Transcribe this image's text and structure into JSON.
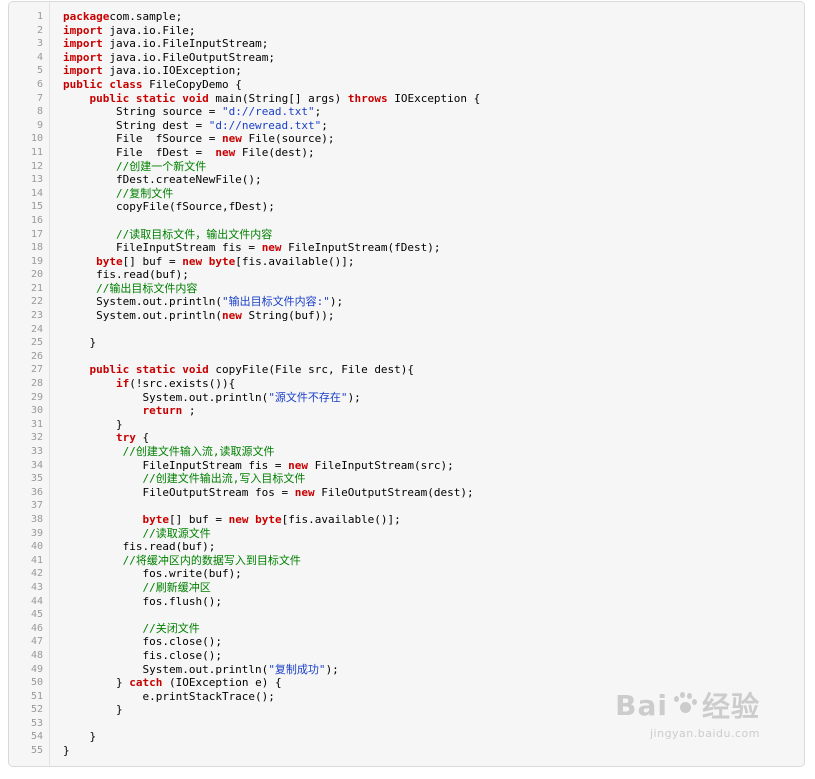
{
  "code": {
    "lines": [
      {
        "n": "1",
        "tokens": [
          [
            "kw",
            "package"
          ],
          [
            "",
            "com.sample;"
          ]
        ]
      },
      {
        "n": "2",
        "tokens": [
          [
            "kw",
            "import"
          ],
          [
            "",
            " java.io.File;"
          ]
        ]
      },
      {
        "n": "3",
        "tokens": [
          [
            "kw",
            "import"
          ],
          [
            "",
            " java.io.FileInputStream;"
          ]
        ]
      },
      {
        "n": "4",
        "tokens": [
          [
            "kw",
            "import"
          ],
          [
            "",
            " java.io.FileOutputStream;"
          ]
        ]
      },
      {
        "n": "5",
        "tokens": [
          [
            "kw",
            "import"
          ],
          [
            "",
            " java.io.IOException;"
          ]
        ]
      },
      {
        "n": "6",
        "tokens": [
          [
            "kw",
            "public"
          ],
          [
            "",
            " "
          ],
          [
            "kw",
            "class"
          ],
          [
            "",
            " FileCopyDemo {"
          ]
        ]
      },
      {
        "n": "7",
        "tokens": [
          [
            "",
            "    "
          ],
          [
            "kw",
            "public"
          ],
          [
            "",
            " "
          ],
          [
            "kw",
            "static"
          ],
          [
            "",
            " "
          ],
          [
            "kw",
            "void"
          ],
          [
            "",
            " main(String[] args) "
          ],
          [
            "kw",
            "throws"
          ],
          [
            "",
            " IOException {"
          ]
        ]
      },
      {
        "n": "8",
        "tokens": [
          [
            "",
            "        String source = "
          ],
          [
            "str",
            "\"d://read.txt\""
          ],
          [
            "",
            ";"
          ]
        ]
      },
      {
        "n": "9",
        "tokens": [
          [
            "",
            "        String dest = "
          ],
          [
            "str",
            "\"d://newread.txt\""
          ],
          [
            "",
            ";"
          ]
        ]
      },
      {
        "n": "10",
        "tokens": [
          [
            "",
            "        File  fSource = "
          ],
          [
            "kw",
            "new"
          ],
          [
            "",
            " File(source);"
          ]
        ]
      },
      {
        "n": "11",
        "tokens": [
          [
            "",
            "        File  fDest =  "
          ],
          [
            "kw",
            "new"
          ],
          [
            "",
            " File(dest);"
          ]
        ]
      },
      {
        "n": "12",
        "tokens": [
          [
            "",
            "        "
          ],
          [
            "cm",
            "//创建一个新文件"
          ]
        ]
      },
      {
        "n": "13",
        "tokens": [
          [
            "",
            "        fDest.createNewFile();"
          ]
        ]
      },
      {
        "n": "14",
        "tokens": [
          [
            "",
            "        "
          ],
          [
            "cm",
            "//复制文件"
          ]
        ]
      },
      {
        "n": "15",
        "tokens": [
          [
            "",
            "        copyFile(fSource,fDest);"
          ]
        ]
      },
      {
        "n": "16",
        "tokens": []
      },
      {
        "n": "17",
        "tokens": [
          [
            "",
            "        "
          ],
          [
            "cm",
            "//读取目标文件，输出文件内容"
          ]
        ]
      },
      {
        "n": "18",
        "tokens": [
          [
            "",
            "        FileInputStream fis = "
          ],
          [
            "kw",
            "new"
          ],
          [
            "",
            " FileInputStream(fDest);"
          ]
        ]
      },
      {
        "n": "19",
        "tokens": [
          [
            "",
            "     "
          ],
          [
            "kw",
            "byte"
          ],
          [
            "",
            "[] buf = "
          ],
          [
            "kw",
            "new"
          ],
          [
            "",
            " "
          ],
          [
            "kw",
            "byte"
          ],
          [
            "",
            "[fis.available()];"
          ]
        ]
      },
      {
        "n": "20",
        "tokens": [
          [
            "",
            "     fis.read(buf);"
          ]
        ]
      },
      {
        "n": "21",
        "tokens": [
          [
            "",
            "     "
          ],
          [
            "cm",
            "//输出目标文件内容"
          ]
        ]
      },
      {
        "n": "22",
        "tokens": [
          [
            "",
            "     System.out.println("
          ],
          [
            "str",
            "\"输出目标文件内容:\""
          ],
          [
            "",
            ");"
          ]
        ]
      },
      {
        "n": "23",
        "tokens": [
          [
            "",
            "     System.out.println("
          ],
          [
            "kw",
            "new"
          ],
          [
            "",
            " String(buf));"
          ]
        ]
      },
      {
        "n": "24",
        "tokens": []
      },
      {
        "n": "25",
        "tokens": [
          [
            "",
            "    }"
          ]
        ]
      },
      {
        "n": "26",
        "tokens": []
      },
      {
        "n": "27",
        "tokens": [
          [
            "",
            "    "
          ],
          [
            "kw",
            "public"
          ],
          [
            "",
            " "
          ],
          [
            "kw",
            "static"
          ],
          [
            "",
            " "
          ],
          [
            "kw",
            "void"
          ],
          [
            "",
            " copyFile(File src, File dest){"
          ]
        ]
      },
      {
        "n": "28",
        "tokens": [
          [
            "",
            "        "
          ],
          [
            "kw",
            "if"
          ],
          [
            "",
            "(!src.exists()){"
          ]
        ]
      },
      {
        "n": "29",
        "tokens": [
          [
            "",
            "            System.out.println("
          ],
          [
            "str",
            "\"源文件不存在\""
          ],
          [
            "",
            ");"
          ]
        ]
      },
      {
        "n": "30",
        "tokens": [
          [
            "",
            "            "
          ],
          [
            "kw",
            "return"
          ],
          [
            "",
            " ;"
          ]
        ]
      },
      {
        "n": "31",
        "tokens": [
          [
            "",
            "        }"
          ]
        ]
      },
      {
        "n": "32",
        "tokens": [
          [
            "",
            "        "
          ],
          [
            "kw",
            "try"
          ],
          [
            "",
            " {"
          ]
        ]
      },
      {
        "n": "33",
        "tokens": [
          [
            "",
            "         "
          ],
          [
            "cm",
            "//创建文件输入流,读取源文件"
          ]
        ]
      },
      {
        "n": "34",
        "tokens": [
          [
            "",
            "            FileInputStream fis = "
          ],
          [
            "kw",
            "new"
          ],
          [
            "",
            " FileInputStream(src);"
          ]
        ]
      },
      {
        "n": "35",
        "tokens": [
          [
            "",
            "            "
          ],
          [
            "cm",
            "//创建文件输出流,写入目标文件"
          ]
        ]
      },
      {
        "n": "36",
        "tokens": [
          [
            "",
            "            FileOutputStream fos = "
          ],
          [
            "kw",
            "new"
          ],
          [
            "",
            " FileOutputStream(dest);"
          ]
        ]
      },
      {
        "n": "37",
        "tokens": []
      },
      {
        "n": "38",
        "tokens": [
          [
            "",
            "            "
          ],
          [
            "kw",
            "byte"
          ],
          [
            "",
            "[] buf = "
          ],
          [
            "kw",
            "new"
          ],
          [
            "",
            " "
          ],
          [
            "kw",
            "byte"
          ],
          [
            "",
            "[fis.available()];"
          ]
        ]
      },
      {
        "n": "39",
        "tokens": [
          [
            "",
            "            "
          ],
          [
            "cm",
            "//读取源文件"
          ]
        ]
      },
      {
        "n": "40",
        "tokens": [
          [
            "",
            "         fis.read(buf);"
          ]
        ]
      },
      {
        "n": "41",
        "tokens": [
          [
            "",
            "         "
          ],
          [
            "cm",
            "//将缓冲区内的数据写入到目标文件"
          ]
        ]
      },
      {
        "n": "42",
        "tokens": [
          [
            "",
            "            fos.write(buf);"
          ]
        ]
      },
      {
        "n": "43",
        "tokens": [
          [
            "",
            "            "
          ],
          [
            "cm",
            "//刷新缓冲区"
          ]
        ]
      },
      {
        "n": "44",
        "tokens": [
          [
            "",
            "            fos.flush();"
          ]
        ]
      },
      {
        "n": "45",
        "tokens": []
      },
      {
        "n": "46",
        "tokens": [
          [
            "",
            "            "
          ],
          [
            "cm",
            "//关闭文件"
          ]
        ]
      },
      {
        "n": "47",
        "tokens": [
          [
            "",
            "            fos.close();"
          ]
        ]
      },
      {
        "n": "48",
        "tokens": [
          [
            "",
            "            fis.close();"
          ]
        ]
      },
      {
        "n": "49",
        "tokens": [
          [
            "",
            "            System.out.println("
          ],
          [
            "str",
            "\"复制成功\""
          ],
          [
            "",
            ");"
          ]
        ]
      },
      {
        "n": "50",
        "tokens": [
          [
            "",
            "        } "
          ],
          [
            "kw",
            "catch"
          ],
          [
            "",
            " (IOException e) {"
          ]
        ]
      },
      {
        "n": "51",
        "tokens": [
          [
            "",
            "            e.printStackTrace();"
          ]
        ]
      },
      {
        "n": "52",
        "tokens": [
          [
            "",
            "        }"
          ]
        ]
      },
      {
        "n": "53",
        "tokens": []
      },
      {
        "n": "54",
        "tokens": [
          [
            "",
            "    }"
          ]
        ]
      },
      {
        "n": "55",
        "tokens": [
          [
            "",
            "}"
          ]
        ]
      }
    ]
  },
  "watermark": {
    "logo_left": "Bai",
    "logo_right": "经验",
    "sub": "jingyan.baidu.com"
  }
}
